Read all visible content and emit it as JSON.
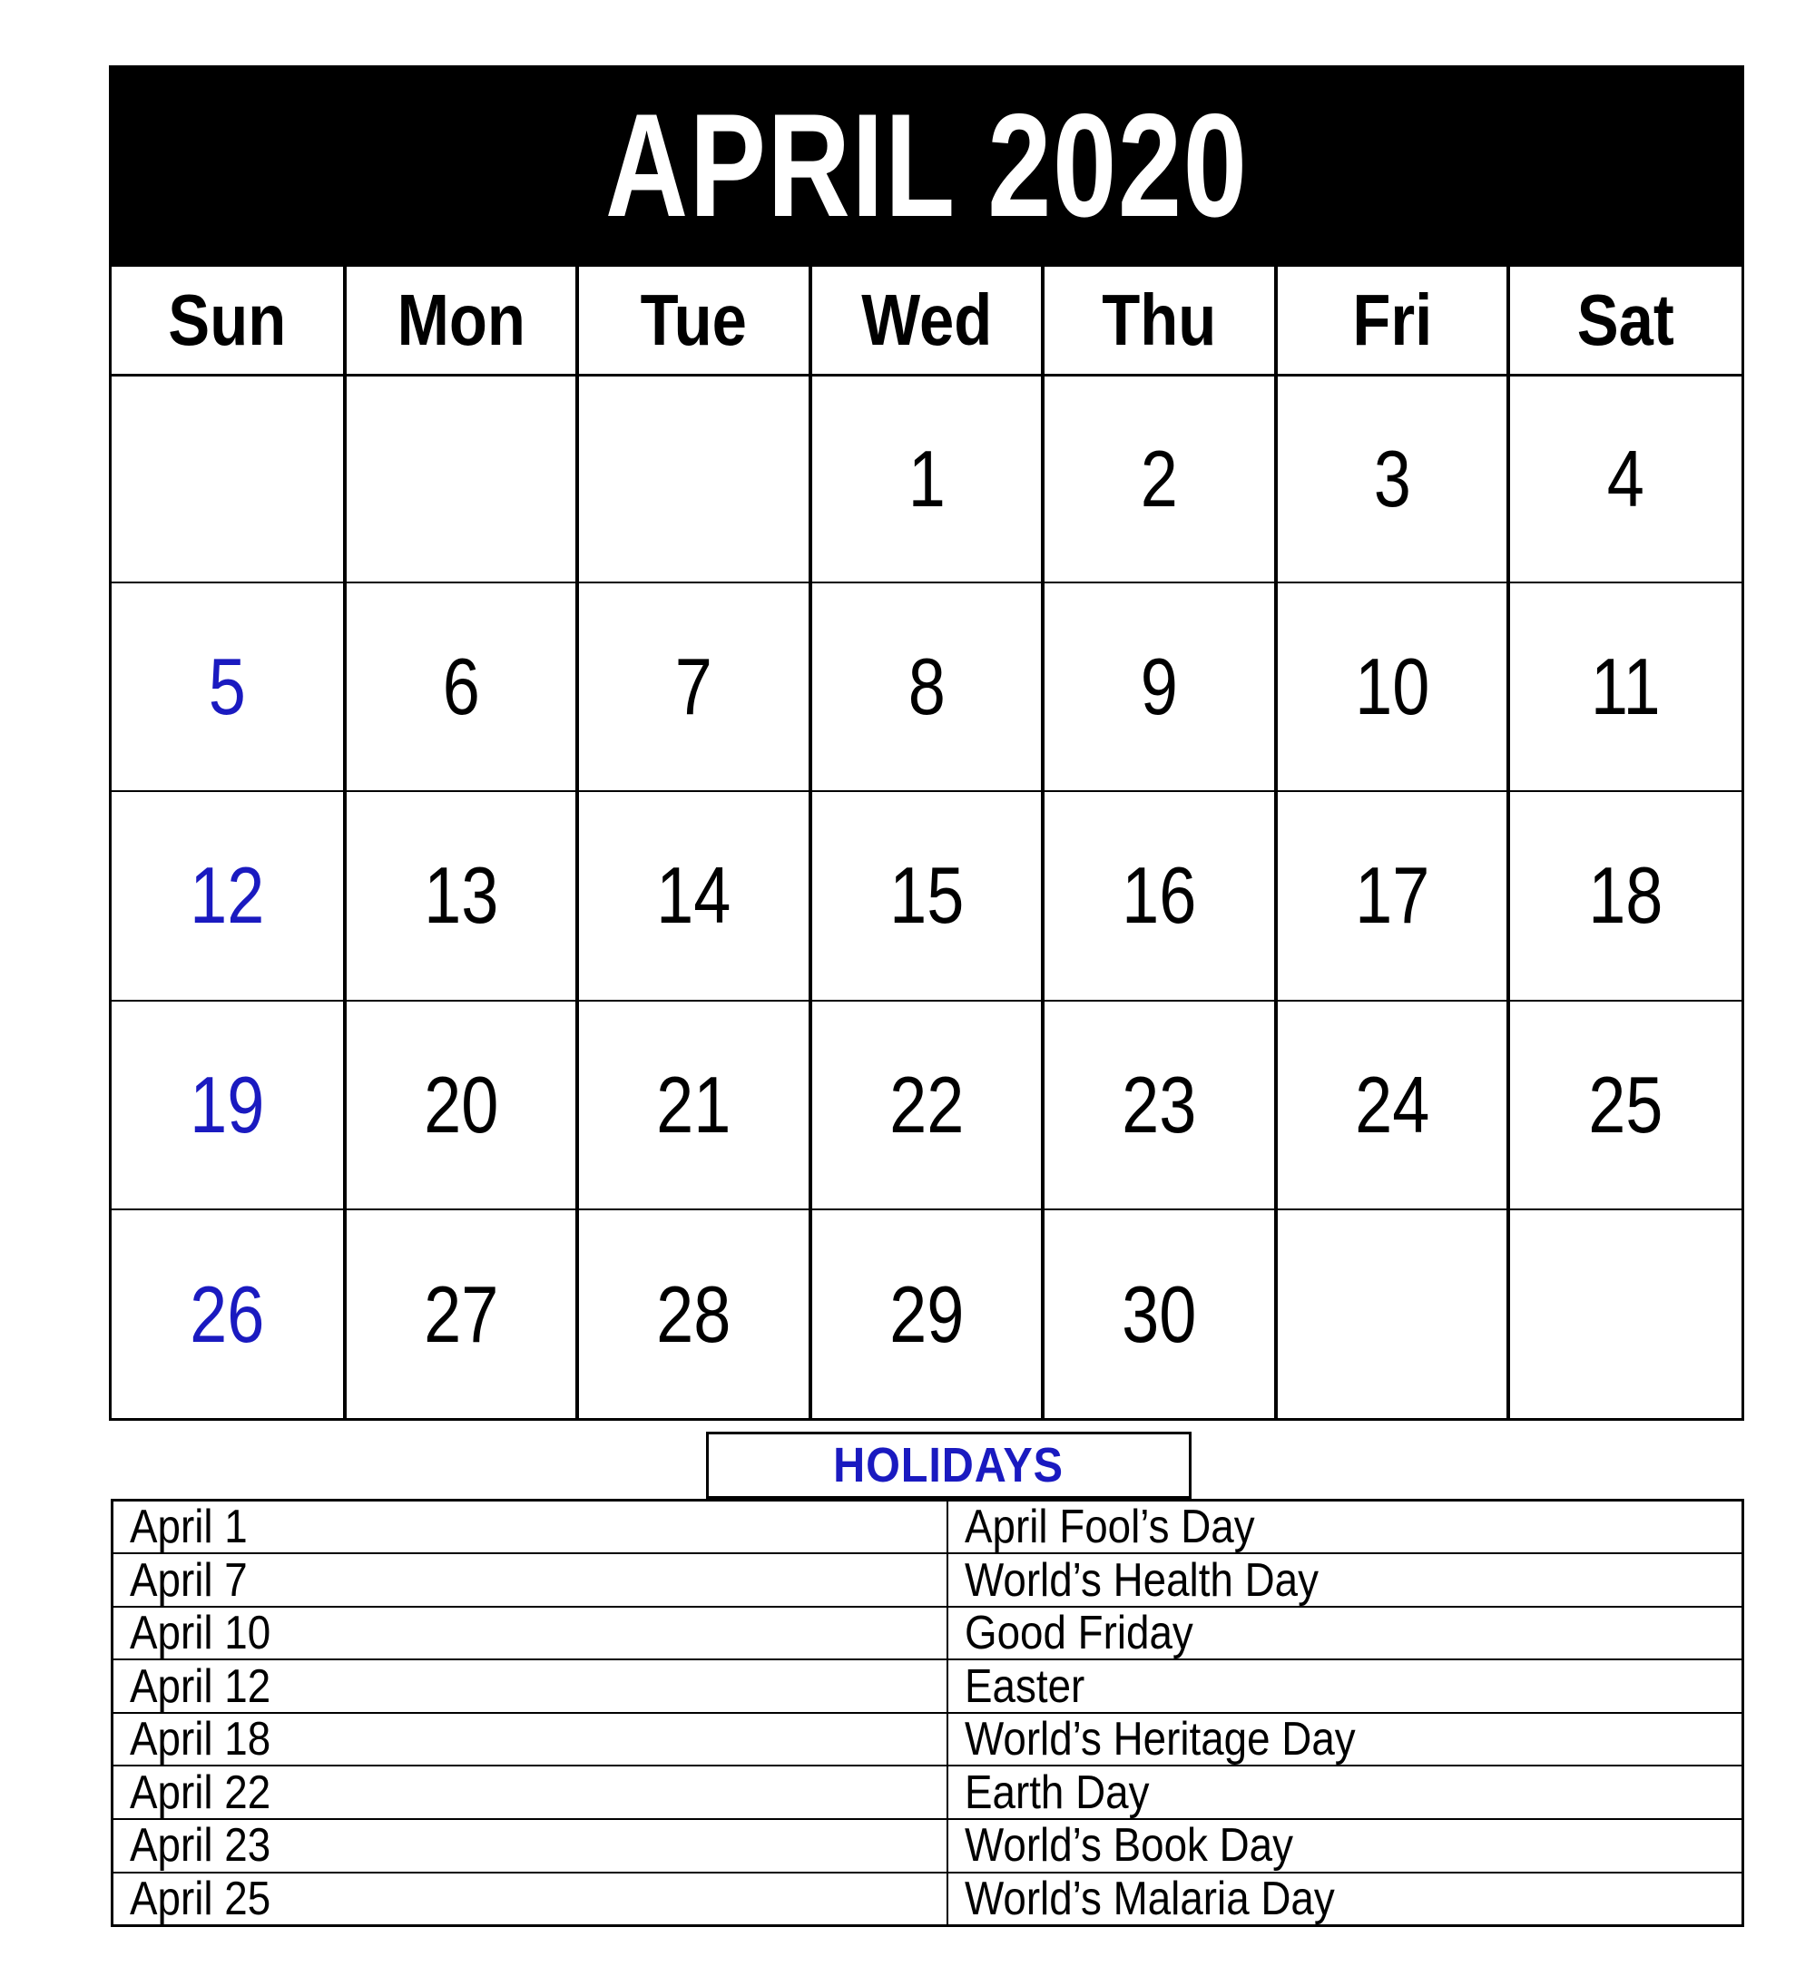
{
  "calendar": {
    "title": "APRIL 2020",
    "month": "APRIL",
    "year": "2020",
    "accent_blue": "#1a1ac0",
    "header_bg": "#000000",
    "header_fg": "#ffffff",
    "weekdays": [
      "Sun",
      "Mon",
      "Tue",
      "Wed",
      "Thu",
      "Fri",
      "Sat"
    ],
    "weeks": [
      [
        {
          "num": "",
          "sunday": false
        },
        {
          "num": "",
          "sunday": false
        },
        {
          "num": "",
          "sunday": false
        },
        {
          "num": "1",
          "sunday": false
        },
        {
          "num": "2",
          "sunday": false
        },
        {
          "num": "3",
          "sunday": false
        },
        {
          "num": "4",
          "sunday": false
        }
      ],
      [
        {
          "num": "5",
          "sunday": true
        },
        {
          "num": "6",
          "sunday": false
        },
        {
          "num": "7",
          "sunday": false
        },
        {
          "num": "8",
          "sunday": false
        },
        {
          "num": "9",
          "sunday": false
        },
        {
          "num": "10",
          "sunday": false
        },
        {
          "num": "11",
          "sunday": false
        }
      ],
      [
        {
          "num": "12",
          "sunday": true
        },
        {
          "num": "13",
          "sunday": false
        },
        {
          "num": "14",
          "sunday": false
        },
        {
          "num": "15",
          "sunday": false
        },
        {
          "num": "16",
          "sunday": false
        },
        {
          "num": "17",
          "sunday": false
        },
        {
          "num": "18",
          "sunday": false
        }
      ],
      [
        {
          "num": "19",
          "sunday": true
        },
        {
          "num": "20",
          "sunday": false
        },
        {
          "num": "21",
          "sunday": false
        },
        {
          "num": "22",
          "sunday": false
        },
        {
          "num": "23",
          "sunday": false
        },
        {
          "num": "24",
          "sunday": false
        },
        {
          "num": "25",
          "sunday": false
        }
      ],
      [
        {
          "num": "26",
          "sunday": true
        },
        {
          "num": "27",
          "sunday": false
        },
        {
          "num": "28",
          "sunday": false
        },
        {
          "num": "29",
          "sunday": false
        },
        {
          "num": "30",
          "sunday": false
        },
        {
          "num": "",
          "sunday": false
        },
        {
          "num": "",
          "sunday": false
        }
      ]
    ]
  },
  "holidays": {
    "banner_label": "HOLIDAYS",
    "rows": [
      {
        "date": "April 1",
        "name": "April Fool’s Day"
      },
      {
        "date": "April 7",
        "name": "World’s Health Day"
      },
      {
        "date": "April 10",
        "name": "Good Friday"
      },
      {
        "date": "April 12",
        "name": "Easter"
      },
      {
        "date": "April 18",
        "name": "World’s Heritage Day"
      },
      {
        "date": "April 22",
        "name": "Earth Day"
      },
      {
        "date": "April 23",
        "name": "World’s Book Day"
      },
      {
        "date": "April 25",
        "name": "World’s Malaria Day"
      }
    ]
  }
}
